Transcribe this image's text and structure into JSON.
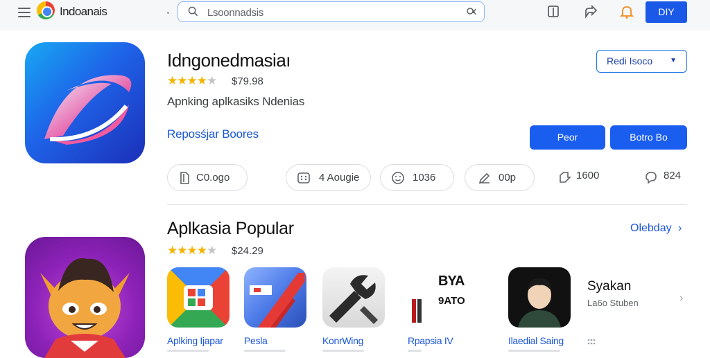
{
  "topbar": {
    "brand": "Indoanais",
    "search_placeholder": "Lsoonnadsis",
    "account_label": "DIY"
  },
  "app": {
    "title": "Idngonedmasiaı",
    "rating_stars": 3.5,
    "price": "$79.98",
    "subtitle": "Apnking aplkasiks Ndenias",
    "developer": "Reposśjar Boores",
    "dropdown_label": "Redi Isoco",
    "primary_button": "Peor",
    "secondary_button": "Botro Bo"
  },
  "stats": [
    {
      "icon": "document-icon",
      "text": "C0.ogo"
    },
    {
      "icon": "calculator-icon",
      "text": "4 Aougie"
    },
    {
      "icon": "face-icon",
      "text": "1036"
    },
    {
      "icon": "pencil-icon",
      "text": "00p"
    },
    {
      "icon": "download-icon",
      "text": "1600"
    },
    {
      "icon": "chat-icon",
      "text": "824"
    }
  ],
  "popular": {
    "section_title": "Aplkasia Popular",
    "see_more": "Olebday",
    "rating_stars": 3.5,
    "price": "$24.29",
    "apps": [
      {
        "name": "Aplking Ijapar",
        "icon": "grid-app-icon"
      },
      {
        "name": "Pesla",
        "icon": "ticket-app-icon"
      },
      {
        "name": "KonrWing",
        "icon": "wrench-app-icon"
      },
      {
        "name": "Rpapsia IV",
        "icon": "logo-app-icon",
        "icon_text_1": "BYA",
        "icon_text_2": "9ATO"
      },
      {
        "name": "Ilaedial Saing",
        "icon": "avatar-app-icon"
      }
    ],
    "featured": {
      "title": "Syakan",
      "sub": "La6o Stuben"
    }
  },
  "colors": {
    "accent": "#1a5ef0",
    "link": "#1a56d6",
    "star": "#f4b400"
  }
}
